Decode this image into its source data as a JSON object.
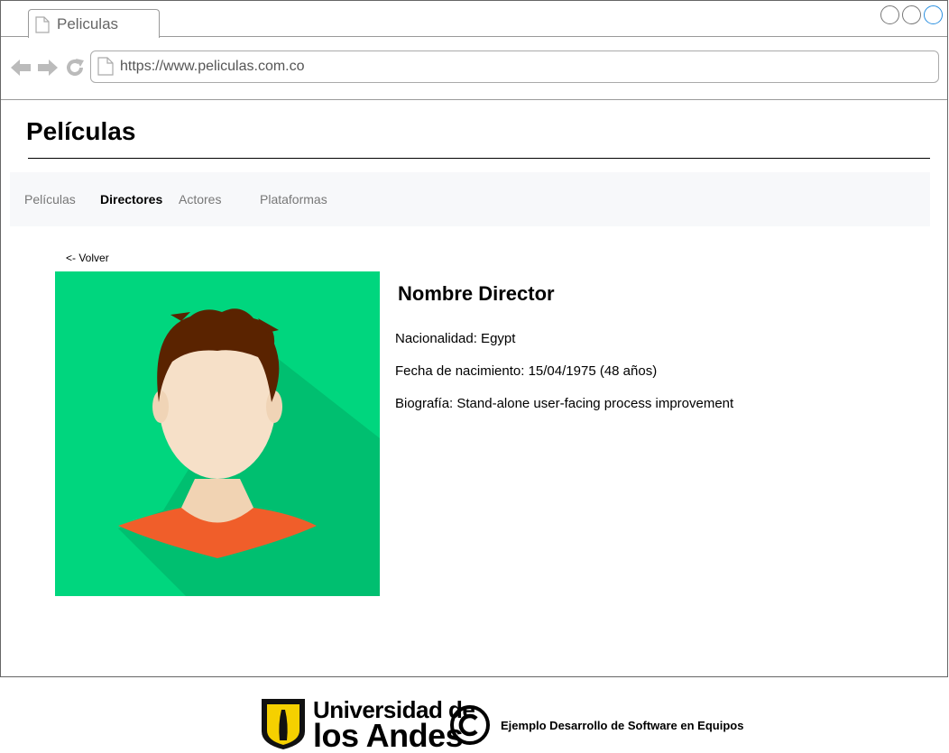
{
  "browser": {
    "tab_title": "Peliculas",
    "url": "https://www.peliculas.com.co",
    "url_icon": "page-icon",
    "accent_color": "#2a8fe0"
  },
  "page": {
    "title": "Películas"
  },
  "nav": {
    "items": [
      {
        "label": "Películas",
        "active": false
      },
      {
        "label": "Directores",
        "active": true
      },
      {
        "label": "Actores",
        "active": false
      },
      {
        "label": "Plataformas",
        "active": false
      }
    ]
  },
  "detail": {
    "back_label": "<- Volver",
    "image": "director-avatar-illustration",
    "name": "Nombre Director",
    "nationality": "Nacionalidad: Egypt",
    "birth_date": "Fecha de nacimiento: 15/04/1975 (48 años)",
    "biography": "Biografía: Stand-alone user-facing process improvement",
    "avatar_bg_color": "#00d67e"
  },
  "footer": {
    "university_line1": "Universidad de",
    "university_line2": "los Andes",
    "copyright_icon": "copyright-icon",
    "text": "Ejemplo Desarrollo de Software en Equipos",
    "logo_color": "#f5d000"
  }
}
